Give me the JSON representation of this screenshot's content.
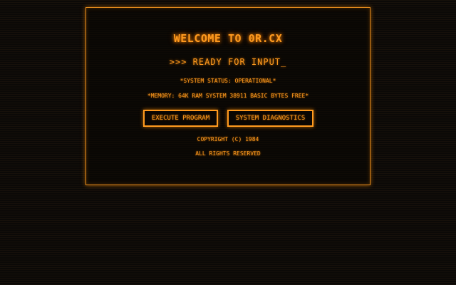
{
  "terminal": {
    "title": "WELCOME TO 0R.CX",
    "prompt": ">>> READY FOR INPUT_",
    "status_line": "*SYSTEM STATUS: OPERATIONAL*",
    "memory_line": "*MEMORY: 64K RAM SYSTEM 38911 BASIC BYTES FREE*",
    "buttons": {
      "execute_label": "EXECUTE PROGRAM",
      "diagnostics_label": "SYSTEM DIAGNOSTICS"
    },
    "copyright": "COPYRIGHT (C) 1984",
    "rights": "ALL RIGHTS RESERVED"
  },
  "colors": {
    "accent": "#ff9a1f",
    "background": "#0b0907",
    "frame_border": "#e38a1d"
  }
}
